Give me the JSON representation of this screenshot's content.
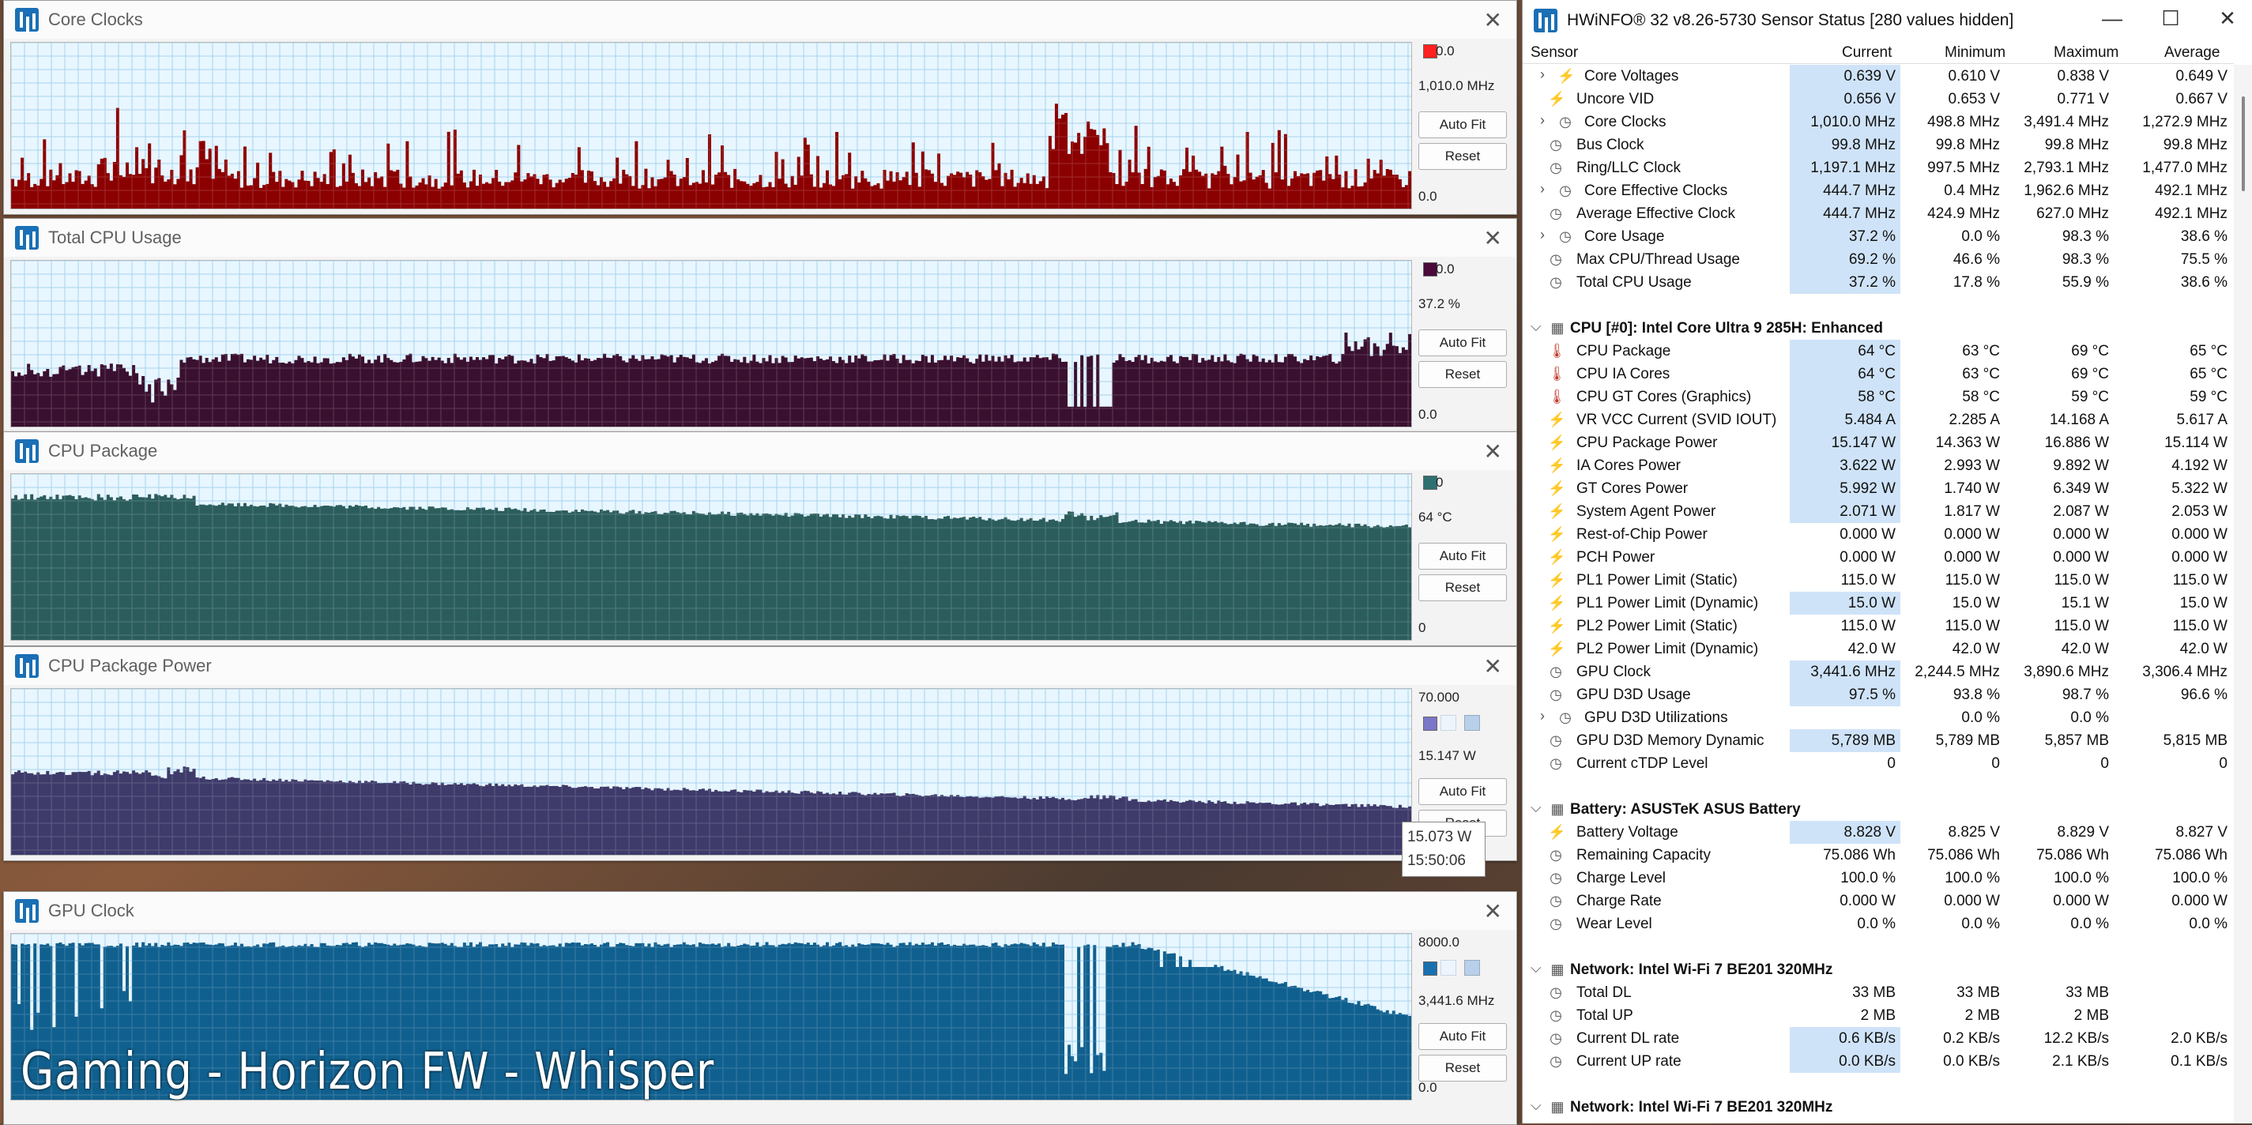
{
  "overlay": {
    "text": "Gaming - Horizon FW - Whisper"
  },
  "graphs": [
    {
      "title": "Core Clocks",
      "top_label": "0.0",
      "current": "1,010.0 MHz",
      "bottom_label": "0.0",
      "color": "#8b0000",
      "swatch": "#ff2020",
      "autofit": "Auto Fit",
      "reset": "Reset"
    },
    {
      "title": "Total CPU Usage",
      "top_label": "0.0",
      "current": "37.2 %",
      "bottom_label": "0.0",
      "color": "#3a1030",
      "swatch": "#4a0a3a",
      "autofit": "Auto Fit",
      "reset": "Reset"
    },
    {
      "title": "CPU Package",
      "top_label": "0",
      "current": "64 °C",
      "bottom_label": "0",
      "color": "#2c5d5d",
      "swatch": "#2e7070",
      "autofit": "Auto Fit",
      "reset": "Reset"
    },
    {
      "title": "CPU Package Power",
      "top_label": "70.000",
      "current": "15.147 W",
      "bottom_label": "",
      "color": "#3e3a6a",
      "swatch": "#7a76c8",
      "autofit": "Auto Fit",
      "reset": "Reset"
    },
    {
      "title": "GPU Clock",
      "top_label": "8000.0",
      "current": "3,441.6 MHz",
      "bottom_label": "0.0",
      "color": "#10608f",
      "swatch": "#1870b0",
      "autofit": "Auto Fit",
      "reset": "Reset"
    }
  ],
  "tooltip": {
    "value": "15.073 W",
    "time": "15:50:06"
  },
  "main": {
    "title": "HWiNFO® 32 v8.26-5730 Sensor Status [280 values hidden]",
    "controls": {
      "minimize": "—",
      "maximize": "☐",
      "close": "✕"
    },
    "headers": {
      "sensor": "Sensor",
      "current": "Current",
      "minimum": "Minimum",
      "maximum": "Maximum",
      "average": "Average"
    },
    "rows": [
      {
        "type": "item",
        "indent": 2,
        "expand": "›",
        "icon": "bolt",
        "name": "Core Voltages",
        "cur": "0.639 V",
        "min": "0.610 V",
        "max": "0.838 V",
        "avg": "0.649 V",
        "hl": true
      },
      {
        "type": "item",
        "indent": 1,
        "icon": "bolt",
        "name": "Uncore VID",
        "cur": "0.656 V",
        "min": "0.653 V",
        "max": "0.771 V",
        "avg": "0.667 V",
        "hl": true
      },
      {
        "type": "item",
        "indent": 2,
        "expand": "›",
        "icon": "clock",
        "name": "Core Clocks",
        "cur": "1,010.0 MHz",
        "min": "498.8 MHz",
        "max": "3,491.4 MHz",
        "avg": "1,272.9 MHz",
        "hl": true
      },
      {
        "type": "item",
        "indent": 1,
        "icon": "clock",
        "name": "Bus Clock",
        "cur": "99.8 MHz",
        "min": "99.8 MHz",
        "max": "99.8 MHz",
        "avg": "99.8 MHz",
        "hl": true
      },
      {
        "type": "item",
        "indent": 1,
        "icon": "clock",
        "name": "Ring/LLC Clock",
        "cur": "1,197.1 MHz",
        "min": "997.5 MHz",
        "max": "2,793.1 MHz",
        "avg": "1,477.0 MHz",
        "hl": true
      },
      {
        "type": "item",
        "indent": 2,
        "expand": "›",
        "icon": "clock",
        "name": "Core Effective Clocks",
        "cur": "444.7 MHz",
        "min": "0.4 MHz",
        "max": "1,962.6 MHz",
        "avg": "492.1 MHz",
        "hl": true
      },
      {
        "type": "item",
        "indent": 1,
        "icon": "clock",
        "name": "Average Effective Clock",
        "cur": "444.7 MHz",
        "min": "424.9 MHz",
        "max": "627.0 MHz",
        "avg": "492.1 MHz",
        "hl": true
      },
      {
        "type": "item",
        "indent": 2,
        "expand": "›",
        "icon": "clock",
        "name": "Core Usage",
        "cur": "37.2 %",
        "min": "0.0 %",
        "max": "98.3 %",
        "avg": "38.6 %",
        "hl": true
      },
      {
        "type": "item",
        "indent": 1,
        "icon": "clock",
        "name": "Max CPU/Thread Usage",
        "cur": "69.2 %",
        "min": "46.6 %",
        "max": "98.3 %",
        "avg": "75.5 %",
        "hl": true
      },
      {
        "type": "item",
        "indent": 1,
        "icon": "clock",
        "name": "Total CPU Usage",
        "cur": "37.2 %",
        "min": "17.8 %",
        "max": "55.9 %",
        "avg": "38.6 %",
        "hl": true
      },
      {
        "type": "blank"
      },
      {
        "type": "group",
        "name": "CPU [#0]: Intel Core Ultra 9 285H: Enhanced"
      },
      {
        "type": "item",
        "indent": 1,
        "icon": "temp",
        "name": "CPU Package",
        "cur": "64 °C",
        "min": "63 °C",
        "max": "69 °C",
        "avg": "65 °C",
        "hl": true
      },
      {
        "type": "item",
        "indent": 1,
        "icon": "temp",
        "name": "CPU IA Cores",
        "cur": "64 °C",
        "min": "63 °C",
        "max": "69 °C",
        "avg": "65 °C",
        "hl": true
      },
      {
        "type": "item",
        "indent": 1,
        "icon": "temp",
        "name": "CPU GT Cores (Graphics)",
        "cur": "58 °C",
        "min": "58 °C",
        "max": "59 °C",
        "avg": "59 °C",
        "hl": true
      },
      {
        "type": "item",
        "indent": 1,
        "icon": "bolt",
        "name": "VR VCC Current (SVID IOUT)",
        "cur": "5.484 A",
        "min": "2.285 A",
        "max": "14.168 A",
        "avg": "5.617 A",
        "hl": true
      },
      {
        "type": "item",
        "indent": 1,
        "icon": "bolt",
        "name": "CPU Package Power",
        "cur": "15.147 W",
        "min": "14.363 W",
        "max": "16.886 W",
        "avg": "15.114 W",
        "hl": true
      },
      {
        "type": "item",
        "indent": 1,
        "icon": "bolt",
        "name": "IA Cores Power",
        "cur": "3.622 W",
        "min": "2.993 W",
        "max": "9.892 W",
        "avg": "4.192 W",
        "hl": true
      },
      {
        "type": "item",
        "indent": 1,
        "icon": "bolt",
        "name": "GT Cores Power",
        "cur": "5.992 W",
        "min": "1.740 W",
        "max": "6.349 W",
        "avg": "5.322 W",
        "hl": true
      },
      {
        "type": "item",
        "indent": 1,
        "icon": "bolt",
        "name": "System Agent Power",
        "cur": "2.071 W",
        "min": "1.817 W",
        "max": "2.087 W",
        "avg": "2.053 W",
        "hl": true
      },
      {
        "type": "item",
        "indent": 1,
        "icon": "bolt",
        "name": "Rest-of-Chip Power",
        "cur": "0.000 W",
        "min": "0.000 W",
        "max": "0.000 W",
        "avg": "0.000 W",
        "hl": false
      },
      {
        "type": "item",
        "indent": 1,
        "icon": "bolt",
        "name": "PCH Power",
        "cur": "0.000 W",
        "min": "0.000 W",
        "max": "0.000 W",
        "avg": "0.000 W",
        "hl": false
      },
      {
        "type": "item",
        "indent": 1,
        "icon": "bolt",
        "name": "PL1 Power Limit (Static)",
        "cur": "115.0 W",
        "min": "115.0 W",
        "max": "115.0 W",
        "avg": "115.0 W",
        "hl": false
      },
      {
        "type": "item",
        "indent": 1,
        "icon": "bolt",
        "name": "PL1 Power Limit (Dynamic)",
        "cur": "15.0 W",
        "min": "15.0 W",
        "max": "15.1 W",
        "avg": "15.0 W",
        "hl": true
      },
      {
        "type": "item",
        "indent": 1,
        "icon": "bolt",
        "name": "PL2 Power Limit (Static)",
        "cur": "115.0 W",
        "min": "115.0 W",
        "max": "115.0 W",
        "avg": "115.0 W",
        "hl": false
      },
      {
        "type": "item",
        "indent": 1,
        "icon": "bolt",
        "name": "PL2 Power Limit (Dynamic)",
        "cur": "42.0 W",
        "min": "42.0 W",
        "max": "42.0 W",
        "avg": "42.0 W",
        "hl": false
      },
      {
        "type": "item",
        "indent": 1,
        "icon": "clock",
        "name": "GPU Clock",
        "cur": "3,441.6 MHz",
        "min": "2,244.5 MHz",
        "max": "3,890.6 MHz",
        "avg": "3,306.4 MHz",
        "hl": true
      },
      {
        "type": "item",
        "indent": 1,
        "icon": "clock",
        "name": "GPU D3D Usage",
        "cur": "97.5 %",
        "min": "93.8 %",
        "max": "98.7 %",
        "avg": "96.6 %",
        "hl": true
      },
      {
        "type": "item",
        "indent": 2,
        "expand": "›",
        "icon": "clock",
        "name": "GPU D3D Utilizations",
        "cur": "",
        "min": "0.0 %",
        "max": "0.0 %",
        "avg": "",
        "hl": false
      },
      {
        "type": "item",
        "indent": 1,
        "icon": "clock",
        "name": "GPU D3D Memory Dynamic",
        "cur": "5,789 MB",
        "min": "5,789 MB",
        "max": "5,857 MB",
        "avg": "5,815 MB",
        "hl": true
      },
      {
        "type": "item",
        "indent": 1,
        "icon": "clock",
        "name": "Current cTDP Level",
        "cur": "0",
        "min": "0",
        "max": "0",
        "avg": "0",
        "hl": false
      },
      {
        "type": "blank"
      },
      {
        "type": "group",
        "name": "Battery: ASUSTeK ASUS Battery"
      },
      {
        "type": "item",
        "indent": 1,
        "icon": "bolt",
        "name": "Battery Voltage",
        "cur": "8.828 V",
        "min": "8.825 V",
        "max": "8.829 V",
        "avg": "8.827 V",
        "hl": true
      },
      {
        "type": "item",
        "indent": 1,
        "icon": "clock",
        "name": "Remaining Capacity",
        "cur": "75.086 Wh",
        "min": "75.086 Wh",
        "max": "75.086 Wh",
        "avg": "75.086 Wh",
        "hl": false
      },
      {
        "type": "item",
        "indent": 1,
        "icon": "clock",
        "name": "Charge Level",
        "cur": "100.0 %",
        "min": "100.0 %",
        "max": "100.0 %",
        "avg": "100.0 %",
        "hl": false
      },
      {
        "type": "item",
        "indent": 1,
        "icon": "clock",
        "name": "Charge Rate",
        "cur": "0.000 W",
        "min": "0.000 W",
        "max": "0.000 W",
        "avg": "0.000 W",
        "hl": false
      },
      {
        "type": "item",
        "indent": 1,
        "icon": "clock",
        "name": "Wear Level",
        "cur": "0.0 %",
        "min": "0.0 %",
        "max": "0.0 %",
        "avg": "0.0 %",
        "hl": false
      },
      {
        "type": "blank"
      },
      {
        "type": "group",
        "name": "Network: Intel Wi-Fi 7 BE201 320MHz"
      },
      {
        "type": "item",
        "indent": 1,
        "icon": "clock",
        "name": "Total DL",
        "cur": "33 MB",
        "min": "33 MB",
        "max": "33 MB",
        "avg": "",
        "hl": false
      },
      {
        "type": "item",
        "indent": 1,
        "icon": "clock",
        "name": "Total UP",
        "cur": "2 MB",
        "min": "2 MB",
        "max": "2 MB",
        "avg": "",
        "hl": false
      },
      {
        "type": "item",
        "indent": 1,
        "icon": "clock",
        "name": "Current DL rate",
        "cur": "0.6 KB/s",
        "min": "0.2 KB/s",
        "max": "12.2 KB/s",
        "avg": "2.0 KB/s",
        "hl": true
      },
      {
        "type": "item",
        "indent": 1,
        "icon": "clock",
        "name": "Current UP rate",
        "cur": "0.0 KB/s",
        "min": "0.0 KB/s",
        "max": "2.1 KB/s",
        "avg": "0.1 KB/s",
        "hl": true
      },
      {
        "type": "blank"
      },
      {
        "type": "group",
        "name": "Network: Intel Wi-Fi 7 BE201 320MHz"
      }
    ]
  }
}
